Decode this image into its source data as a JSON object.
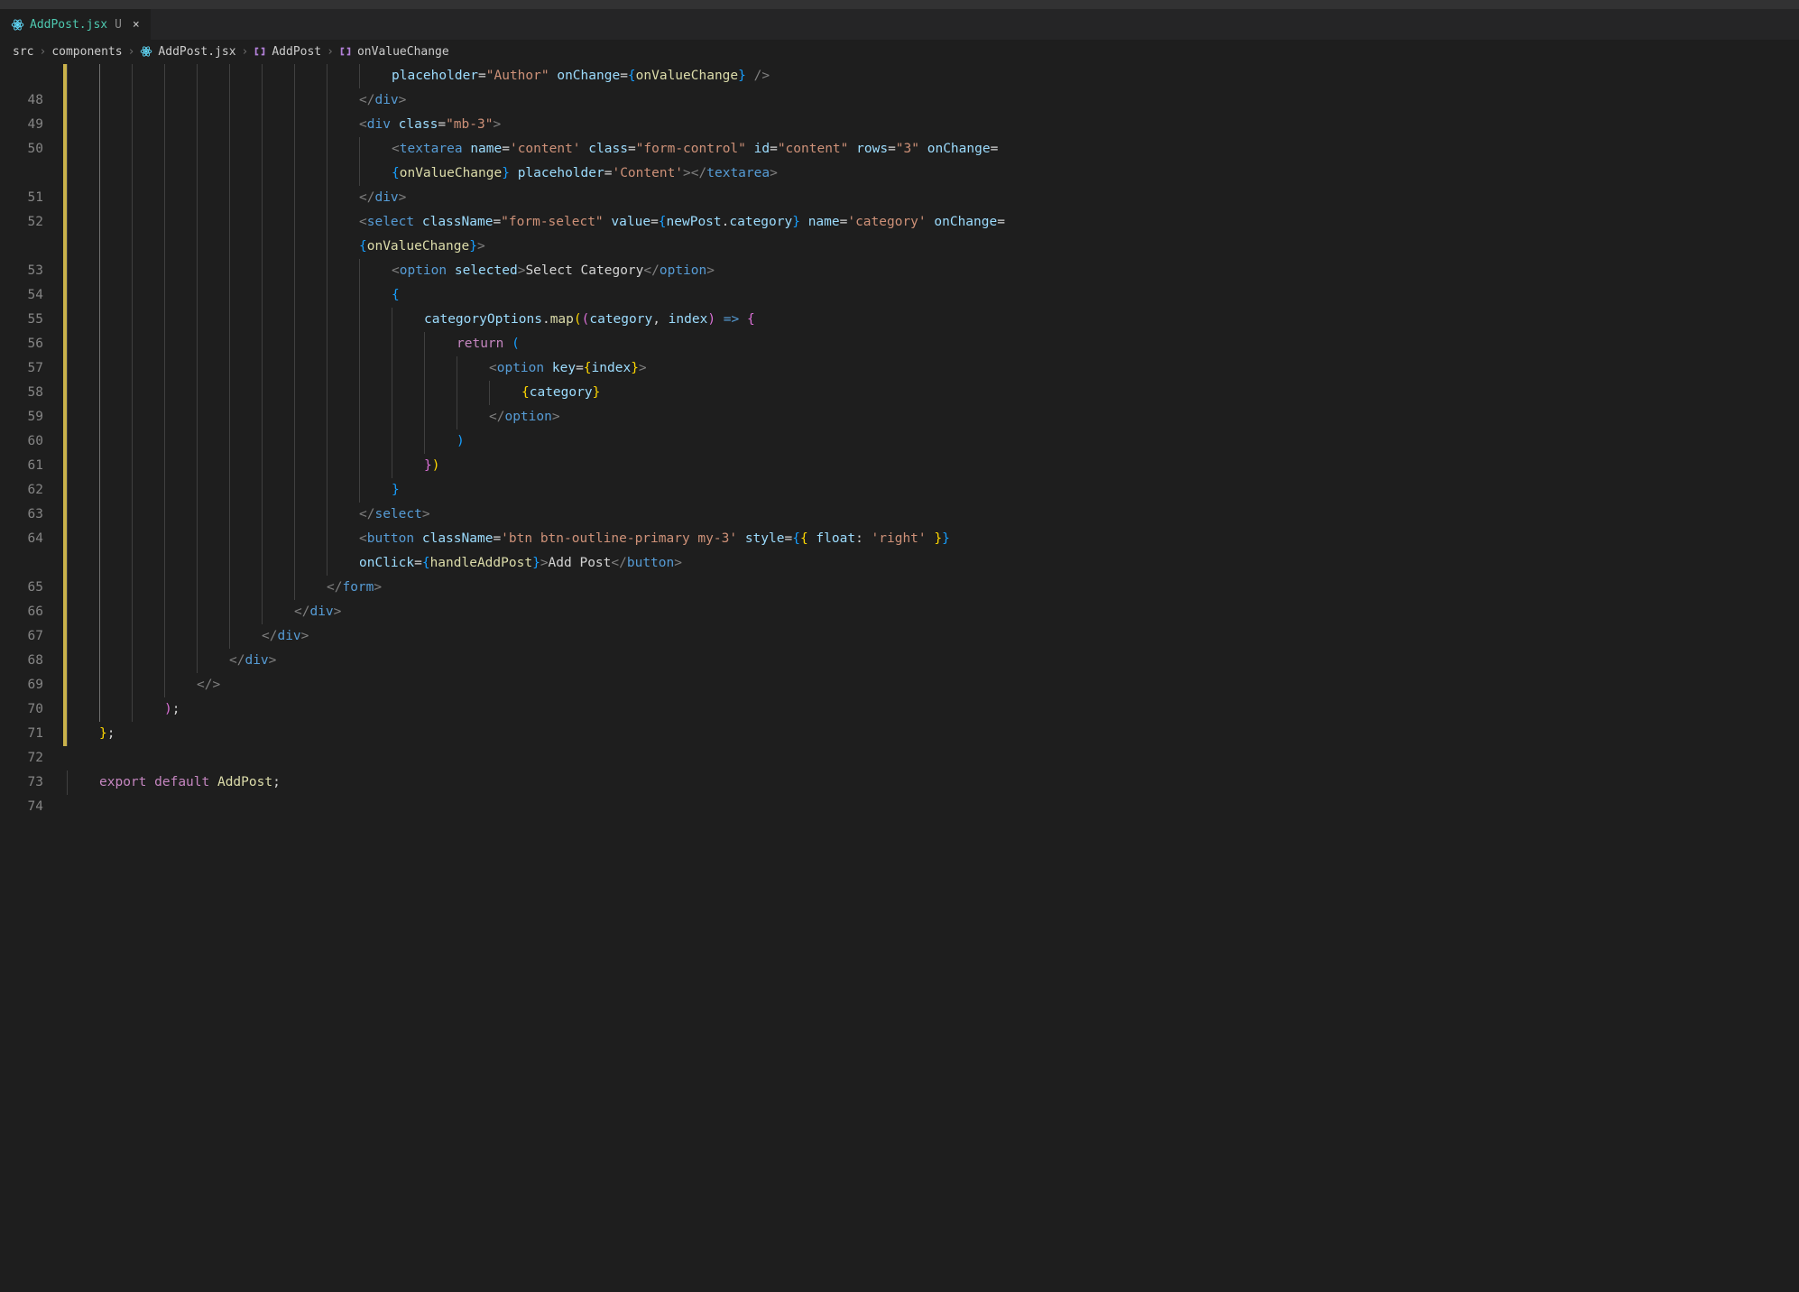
{
  "tab": {
    "filename": "AddPost.jsx",
    "modified_marker": "U",
    "close": "×"
  },
  "breadcrumb": {
    "parts": [
      "src",
      "components",
      "AddPost.jsx",
      "AddPost",
      "onValueChange"
    ],
    "sep": "›"
  },
  "line_numbers": [
    "",
    "48",
    "49",
    "50",
    "",
    "51",
    "52",
    "",
    "53",
    "54",
    "55",
    "56",
    "57",
    "58",
    "59",
    "60",
    "61",
    "62",
    "63",
    "64",
    "",
    "65",
    "66",
    "67",
    "68",
    "69",
    "70",
    "71",
    "72",
    "73",
    "74"
  ],
  "mod_flags": [
    true,
    true,
    true,
    true,
    true,
    true,
    true,
    true,
    true,
    true,
    true,
    true,
    true,
    true,
    true,
    true,
    true,
    true,
    true,
    true,
    true,
    true,
    true,
    true,
    true,
    true,
    true,
    true,
    false,
    false,
    false
  ],
  "code_tokens": {
    "l0": [
      [
        "attr",
        "placeholder"
      ],
      [
        "txt",
        "="
      ],
      [
        "str",
        "\"Author\""
      ],
      [
        "txt",
        " "
      ],
      [
        "attr",
        "onChange"
      ],
      [
        "txt",
        "="
      ],
      [
        "brace-b",
        "{"
      ],
      [
        "func",
        "onValueChange"
      ],
      [
        "brace-b",
        "}"
      ],
      [
        "txt",
        " "
      ],
      [
        "punc",
        "/>"
      ]
    ],
    "l1": [
      [
        "punc",
        "</"
      ],
      [
        "tag",
        "div"
      ],
      [
        "punc",
        ">"
      ]
    ],
    "l2": [
      [
        "punc",
        "<"
      ],
      [
        "tag",
        "div"
      ],
      [
        "txt",
        " "
      ],
      [
        "attr",
        "class"
      ],
      [
        "txt",
        "="
      ],
      [
        "str",
        "\"mb-3\""
      ],
      [
        "punc",
        ">"
      ]
    ],
    "l3": [
      [
        "punc",
        "<"
      ],
      [
        "tag",
        "textarea"
      ],
      [
        "txt",
        " "
      ],
      [
        "attr",
        "name"
      ],
      [
        "txt",
        "="
      ],
      [
        "str",
        "'content'"
      ],
      [
        "txt",
        " "
      ],
      [
        "attr",
        "class"
      ],
      [
        "txt",
        "="
      ],
      [
        "str",
        "\"form-control\""
      ],
      [
        "txt",
        " "
      ],
      [
        "attr",
        "id"
      ],
      [
        "txt",
        "="
      ],
      [
        "str",
        "\"content\""
      ],
      [
        "txt",
        " "
      ],
      [
        "attr",
        "rows"
      ],
      [
        "txt",
        "="
      ],
      [
        "str",
        "\"3\""
      ],
      [
        "txt",
        " "
      ],
      [
        "attr",
        "onChange"
      ],
      [
        "txt",
        "="
      ]
    ],
    "l3b": [
      [
        "brace-b",
        "{"
      ],
      [
        "func",
        "onValueChange"
      ],
      [
        "brace-b",
        "}"
      ],
      [
        "txt",
        " "
      ],
      [
        "attr",
        "placeholder"
      ],
      [
        "txt",
        "="
      ],
      [
        "str",
        "'Content'"
      ],
      [
        "punc",
        "></"
      ],
      [
        "tag",
        "textarea"
      ],
      [
        "punc",
        ">"
      ]
    ],
    "l4": [
      [
        "punc",
        "</"
      ],
      [
        "tag",
        "div"
      ],
      [
        "punc",
        ">"
      ]
    ],
    "l5": [
      [
        "punc",
        "<"
      ],
      [
        "tag",
        "select"
      ],
      [
        "txt",
        " "
      ],
      [
        "attr",
        "className"
      ],
      [
        "txt",
        "="
      ],
      [
        "str",
        "\"form-select\""
      ],
      [
        "txt",
        " "
      ],
      [
        "attr",
        "value"
      ],
      [
        "txt",
        "="
      ],
      [
        "brace-b",
        "{"
      ],
      [
        "var",
        "newPost"
      ],
      [
        "txt",
        "."
      ],
      [
        "var",
        "category"
      ],
      [
        "brace-b",
        "}"
      ],
      [
        "txt",
        " "
      ],
      [
        "attr",
        "name"
      ],
      [
        "txt",
        "="
      ],
      [
        "str",
        "'category'"
      ],
      [
        "txt",
        " "
      ],
      [
        "attr",
        "onChange"
      ],
      [
        "txt",
        "="
      ]
    ],
    "l5b": [
      [
        "brace-b",
        "{"
      ],
      [
        "func",
        "onValueChange"
      ],
      [
        "brace-b",
        "}"
      ],
      [
        "punc",
        ">"
      ]
    ],
    "l6": [
      [
        "punc",
        "<"
      ],
      [
        "tag",
        "option"
      ],
      [
        "txt",
        " "
      ],
      [
        "attr",
        "selected"
      ],
      [
        "punc",
        ">"
      ],
      [
        "txt",
        "Select Category"
      ],
      [
        "punc",
        "</"
      ],
      [
        "tag",
        "option"
      ],
      [
        "punc",
        ">"
      ]
    ],
    "l7": [
      [
        "brace-b",
        "{"
      ]
    ],
    "l8": [
      [
        "var",
        "categoryOptions"
      ],
      [
        "txt",
        "."
      ],
      [
        "func",
        "map"
      ],
      [
        "brace-y",
        "("
      ],
      [
        "brace-p",
        "("
      ],
      [
        "param",
        "category"
      ],
      [
        "txt",
        ", "
      ],
      [
        "param",
        "index"
      ],
      [
        "brace-p",
        ")"
      ],
      [
        "txt",
        " "
      ],
      [
        "arrow",
        "=>"
      ],
      [
        "txt",
        " "
      ],
      [
        "brace-p",
        "{"
      ]
    ],
    "l9": [
      [
        "kw",
        "return"
      ],
      [
        "txt",
        " "
      ],
      [
        "brace-b",
        "("
      ]
    ],
    "l10": [
      [
        "punc",
        "<"
      ],
      [
        "tag",
        "option"
      ],
      [
        "txt",
        " "
      ],
      [
        "attr",
        "key"
      ],
      [
        "txt",
        "="
      ],
      [
        "brace-y",
        "{"
      ],
      [
        "var",
        "index"
      ],
      [
        "brace-y",
        "}"
      ],
      [
        "punc",
        ">"
      ]
    ],
    "l11": [
      [
        "brace-y",
        "{"
      ],
      [
        "var",
        "category"
      ],
      [
        "brace-y",
        "}"
      ]
    ],
    "l12": [
      [
        "punc",
        "</"
      ],
      [
        "tag",
        "option"
      ],
      [
        "punc",
        ">"
      ]
    ],
    "l13": [
      [
        "brace-b",
        ")"
      ]
    ],
    "l14": [
      [
        "brace-p",
        "}"
      ],
      [
        "brace-y",
        ")"
      ]
    ],
    "l15": [
      [
        "brace-b",
        "}"
      ]
    ],
    "l16": [
      [
        "punc",
        "</"
      ],
      [
        "tag",
        "select"
      ],
      [
        "punc",
        ">"
      ]
    ],
    "l17": [
      [
        "punc",
        "<"
      ],
      [
        "tag",
        "button"
      ],
      [
        "txt",
        " "
      ],
      [
        "attr",
        "className"
      ],
      [
        "txt",
        "="
      ],
      [
        "str",
        "'btn btn-outline-primary my-3'"
      ],
      [
        "txt",
        " "
      ],
      [
        "attr",
        "style"
      ],
      [
        "txt",
        "="
      ],
      [
        "brace-b",
        "{"
      ],
      [
        "brace-y",
        "{"
      ],
      [
        "txt",
        " "
      ],
      [
        "var",
        "float"
      ],
      [
        "txt",
        ": "
      ],
      [
        "str",
        "'right'"
      ],
      [
        "txt",
        " "
      ],
      [
        "brace-y",
        "}"
      ],
      [
        "brace-b",
        "}"
      ]
    ],
    "l17b": [
      [
        "attr",
        "onClick"
      ],
      [
        "txt",
        "="
      ],
      [
        "brace-b",
        "{"
      ],
      [
        "func",
        "handleAddPost"
      ],
      [
        "brace-b",
        "}"
      ],
      [
        "punc",
        ">"
      ],
      [
        "txt",
        "Add Post"
      ],
      [
        "punc",
        "</"
      ],
      [
        "tag",
        "button"
      ],
      [
        "punc",
        ">"
      ]
    ],
    "l18": [
      [
        "punc",
        "</"
      ],
      [
        "tag",
        "form"
      ],
      [
        "punc",
        ">"
      ]
    ],
    "l19": [
      [
        "punc",
        "</"
      ],
      [
        "tag",
        "div"
      ],
      [
        "punc",
        ">"
      ]
    ],
    "l20": [
      [
        "punc",
        "</"
      ],
      [
        "tag",
        "div"
      ],
      [
        "punc",
        ">"
      ]
    ],
    "l21": [
      [
        "punc",
        "</"
      ],
      [
        "tag",
        "div"
      ],
      [
        "punc",
        ">"
      ]
    ],
    "l22": [
      [
        "punc",
        "</>"
      ]
    ],
    "l23": [
      [
        "brace-p",
        ")"
      ],
      [
        "txt",
        ";"
      ]
    ],
    "l24": [
      [
        "brace-y",
        "}"
      ],
      [
        "txt",
        ";"
      ]
    ],
    "l25": [],
    "l26": [
      [
        "kw",
        "export"
      ],
      [
        "txt",
        " "
      ],
      [
        "kw",
        "default"
      ],
      [
        "txt",
        " "
      ],
      [
        "func",
        "AddPost"
      ],
      [
        "txt",
        ";"
      ]
    ],
    "l27": []
  },
  "indent": {
    "l0": 10,
    "l1": 9,
    "l2": 9,
    "l3": 10,
    "l3b": 10,
    "l4": 9,
    "l5": 9,
    "l5b": 9,
    "l6": 10,
    "l7": 10,
    "l8": 11,
    "l9": 12,
    "l10": 13,
    "l11": 14,
    "l12": 13,
    "l13": 12,
    "l14": 11,
    "l15": 10,
    "l16": 9,
    "l17": 9,
    "l17b": 9,
    "l18": 8,
    "l19": 7,
    "l20": 6,
    "l21": 5,
    "l22": 4,
    "l23": 3,
    "l24": 1,
    "l25": 0,
    "l26": 1,
    "l27": 0
  },
  "line_order": [
    "l0",
    "l1",
    "l2",
    "l3",
    "l3b",
    "l4",
    "l5",
    "l5b",
    "l6",
    "l7",
    "l8",
    "l9",
    "l10",
    "l11",
    "l12",
    "l13",
    "l14",
    "l15",
    "l16",
    "l17",
    "l17b",
    "l18",
    "l19",
    "l20",
    "l21",
    "l22",
    "l23",
    "l24",
    "l25",
    "l26",
    "l27"
  ]
}
